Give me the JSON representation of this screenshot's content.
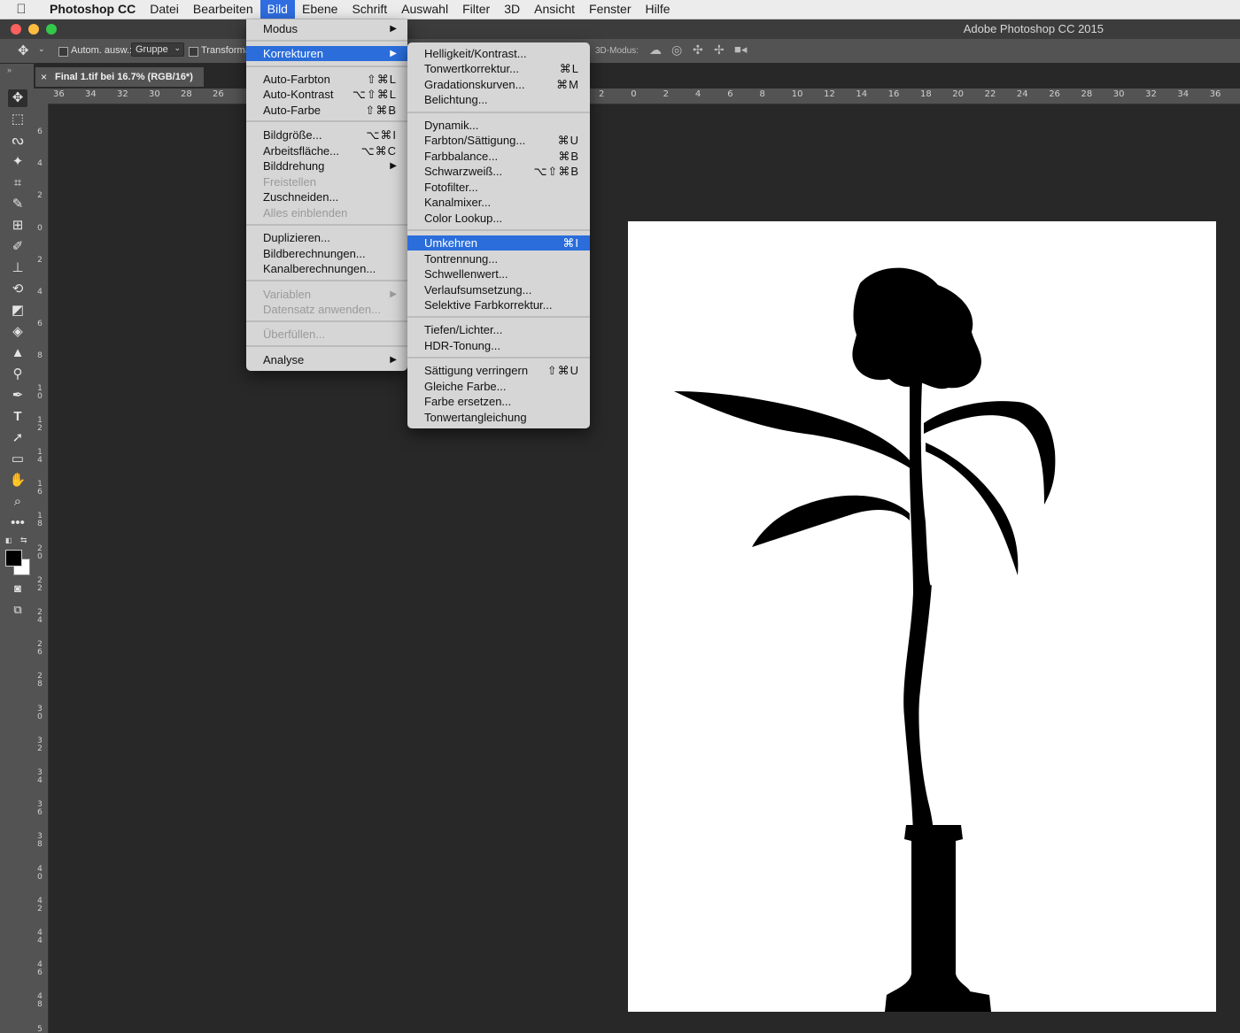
{
  "menubar": {
    "apple_icon": "",
    "items": [
      "Photoshop CC",
      "Datei",
      "Bearbeiten",
      "Bild",
      "Ebene",
      "Schrift",
      "Auswahl",
      "Filter",
      "3D",
      "Ansicht",
      "Fenster",
      "Hilfe"
    ],
    "active": "Bild"
  },
  "window": {
    "title": "Adobe Photoshop CC 2015"
  },
  "options": {
    "auto_select": "Autom. ausw.:",
    "group": "Gruppe",
    "transform": "Transforma",
    "mode3d": "3D-Modus:"
  },
  "document": {
    "tab_title": "Final 1.tif bei 16.7% (RGB/16*)",
    "close": "×"
  },
  "rulers": {
    "left_h": [
      "36",
      "34",
      "32",
      "30",
      "28",
      "26"
    ],
    "right_h": [
      "2",
      "0",
      "2",
      "4",
      "6",
      "8",
      "10",
      "12",
      "14",
      "16",
      "18",
      "20",
      "22",
      "24",
      "26",
      "28",
      "30",
      "32",
      "34",
      "36"
    ],
    "v": [
      "6",
      "4",
      "2",
      "0",
      "2",
      "4",
      "6",
      "8",
      "10",
      "12",
      "14",
      "16",
      "18",
      "20",
      "22",
      "24",
      "26",
      "28",
      "30",
      "32",
      "34",
      "36",
      "38",
      "40",
      "42",
      "44",
      "46",
      "48",
      "5"
    ]
  },
  "bild_menu": {
    "modus": "Modus",
    "korrekturen": "Korrekturen",
    "auto_farbton": {
      "label": "Auto-Farbton",
      "shortcut": "⇧⌘L"
    },
    "auto_kontrast": {
      "label": "Auto-Kontrast",
      "shortcut": "⌥⇧⌘L"
    },
    "auto_farbe": {
      "label": "Auto-Farbe",
      "shortcut": "⇧⌘B"
    },
    "bildgroesse": {
      "label": "Bildgröße...",
      "shortcut": "⌥⌘I"
    },
    "arbeitsflaeche": {
      "label": "Arbeitsfläche...",
      "shortcut": "⌥⌘C"
    },
    "bilddrehung": "Bilddrehung",
    "freistellen": "Freistellen",
    "zuschneiden": "Zuschneiden...",
    "alles_einblenden": "Alles einblenden",
    "duplizieren": "Duplizieren...",
    "bildberechnungen": "Bildberechnungen...",
    "kanalberechnungen": "Kanalberechnungen...",
    "variablen": "Variablen",
    "datensatz": "Datensatz anwenden...",
    "ueberfuellen": "Überfüllen...",
    "analyse": "Analyse"
  },
  "korrekturen_menu": {
    "helligkeit": "Helligkeit/Kontrast...",
    "tonwertkorrektur": {
      "label": "Tonwertkorrektur...",
      "shortcut": "⌘L"
    },
    "gradation": {
      "label": "Gradationskurven...",
      "shortcut": "⌘M"
    },
    "belichtung": "Belichtung...",
    "dynamik": "Dynamik...",
    "farbton": {
      "label": "Farbton/Sättigung...",
      "shortcut": "⌘U"
    },
    "farbbalance": {
      "label": "Farbbalance...",
      "shortcut": "⌘B"
    },
    "schwarzweiss": {
      "label": "Schwarzweiß...",
      "shortcut": "⌥⇧⌘B"
    },
    "fotofilter": "Fotofilter...",
    "kanalmixer": "Kanalmixer...",
    "color_lookup": "Color Lookup...",
    "umkehren": {
      "label": "Umkehren",
      "shortcut": "⌘I"
    },
    "tontrennung": "Tontrennung...",
    "schwellenwert": "Schwellenwert...",
    "verlauf": "Verlaufsumsetzung...",
    "selektive": "Selektive Farbkorrektur...",
    "tiefen": "Tiefen/Lichter...",
    "hdr": "HDR-Tonung...",
    "saettigung": {
      "label": "Sättigung verringern",
      "shortcut": "⇧⌘U"
    },
    "gleiche": "Gleiche Farbe...",
    "farbe_ersetzen": "Farbe ersetzen...",
    "tonwertangleichung": "Tonwertangleichung"
  },
  "submenu_arrow": "▶",
  "colors": {
    "menu_highlight": "#2a6ddb",
    "menubar_active": "#2f6de1",
    "workspace": "#282828",
    "panel": "#535353"
  }
}
